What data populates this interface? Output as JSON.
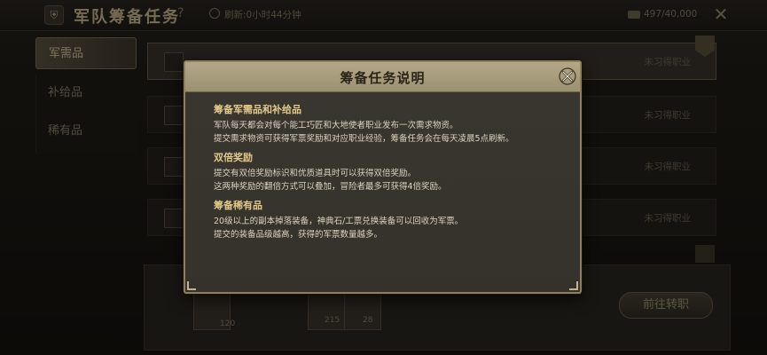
{
  "header": {
    "title": "军队筹备任务",
    "help": "?",
    "refresh_text": "刷新:0小时44分钟",
    "currency_text": "497/40,000"
  },
  "tabs": [
    {
      "label": "军需品"
    },
    {
      "label": "补给品"
    },
    {
      "label": "稀有品"
    }
  ],
  "rows": [
    {
      "status": "未习得职业"
    },
    {
      "status": "未习得职业"
    },
    {
      "status": "未习得职业"
    },
    {
      "status": "未习得职业"
    }
  ],
  "bottom": {
    "item_counts": [
      "120",
      "215",
      "28"
    ],
    "transfer_button": "前往转职"
  },
  "dialog": {
    "title": "筹备任务说明",
    "sections": [
      {
        "heading": "筹备军需品和补给品",
        "lines": [
          "军队每天都会对每个能工巧匠和大地使者职业发布一次需求物资。",
          "提交需求物资可获得军票奖励和对应职业经验，筹备任务会在每天凌晨5点刷新。"
        ]
      },
      {
        "heading": "双倍奖励",
        "lines": [
          "提交有双倍奖励标识和优质道具时可以获得双倍奖励。",
          "这两种奖励的翻倍方式可以叠加，冒险者最多可获得4倍奖励。"
        ]
      },
      {
        "heading": "筹备稀有品",
        "lines": [
          "20级以上的副本掉落装备，神典石/工票兑换装备可以回收为军票。",
          "提交的装备品级越高，获得的军票数量越多。"
        ]
      }
    ]
  }
}
